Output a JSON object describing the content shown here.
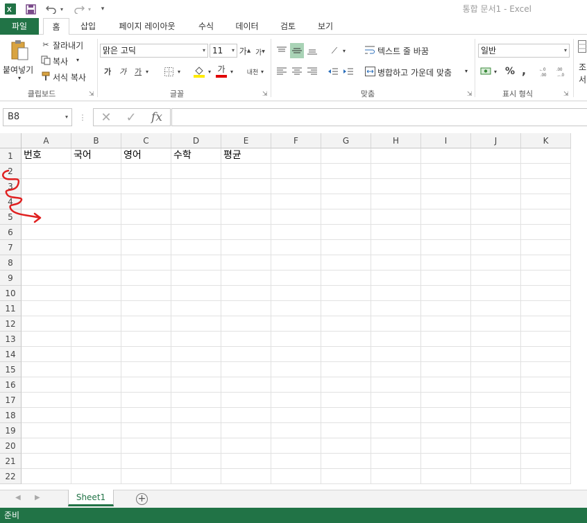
{
  "window": {
    "title": "통합 문서1 - Excel"
  },
  "quick_access": {
    "app_icon": "excel-logo-icon",
    "save_icon": "save-icon",
    "undo_icon": "undo-icon",
    "redo_icon": "redo-icon",
    "customize_icon": "customize-quick-access-icon"
  },
  "tabs": [
    {
      "label": "파일"
    },
    {
      "label": "홈"
    },
    {
      "label": "삽입"
    },
    {
      "label": "페이지 레이아웃"
    },
    {
      "label": "수식"
    },
    {
      "label": "데이터"
    },
    {
      "label": "검토"
    },
    {
      "label": "보기"
    }
  ],
  "ribbon": {
    "clipboard": {
      "paste": "붙여넣기",
      "cut": "잘라내기",
      "copy": "복사",
      "format_painter": "서식 복사",
      "group_label": "클립보드"
    },
    "font": {
      "font_name": "맑은 고딕",
      "font_size": "11",
      "grow": "가",
      "shrink": "가",
      "bold": "가",
      "italic": "가",
      "underline": "가",
      "font_color": "가",
      "phonetic": "내천",
      "group_label": "글꼴"
    },
    "alignment": {
      "wrap_text": "텍스트 줄 바꿈",
      "merge_center": "병합하고 가운데 맞춤",
      "group_label": "맞춤"
    },
    "number": {
      "format": "일반",
      "percent": "%",
      "comma": ",",
      "group_label": "표시 형식"
    },
    "styles": {
      "partial_label_1": "조",
      "partial_label_2": "서"
    }
  },
  "formula_bar": {
    "name_box": "B8",
    "fx": "fx",
    "formula": ""
  },
  "grid": {
    "columns": [
      "A",
      "B",
      "C",
      "D",
      "E",
      "F",
      "G",
      "H",
      "I",
      "J",
      "K"
    ],
    "rows": [
      "1",
      "2",
      "3",
      "4",
      "5",
      "6",
      "7",
      "8",
      "9",
      "10",
      "11",
      "12",
      "13",
      "14",
      "15",
      "16",
      "17",
      "18",
      "19",
      "20",
      "21",
      "22"
    ],
    "row1": [
      "번호",
      "국어",
      "영어",
      "수학",
      "평균"
    ]
  },
  "annotation": {
    "color": "#e02020"
  },
  "sheets": {
    "tabs": [
      "Sheet1"
    ],
    "add": "+"
  },
  "status": {
    "text": "준비"
  },
  "colors": {
    "excel_green": "#217346",
    "align_highlight": "#a9d3b6"
  }
}
